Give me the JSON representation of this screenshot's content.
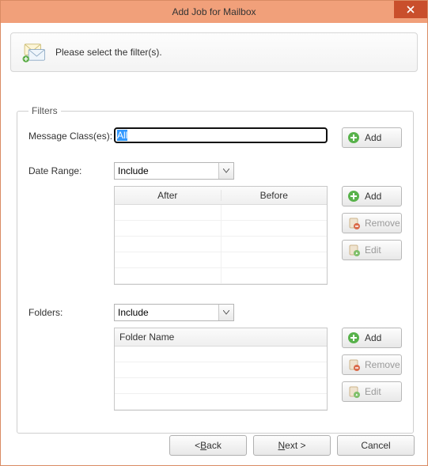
{
  "window": {
    "title": "Add Job for Mailbox"
  },
  "banner": {
    "text": "Please select the filter(s)."
  },
  "filters": {
    "legend": "Filters",
    "message_class": {
      "label": "Message Class(es):",
      "value": "All"
    },
    "date_range": {
      "label": "Date Range:",
      "mode": "Include",
      "columns": {
        "after": "After",
        "before": "Before"
      }
    },
    "folders": {
      "label": "Folders:",
      "mode": "Include",
      "column": "Folder Name"
    }
  },
  "buttons": {
    "add": "Add",
    "remove": "Remove",
    "edit": "Edit"
  },
  "footer": {
    "back_prefix": "< ",
    "back_u": "B",
    "back_rest": "ack",
    "next_u": "N",
    "next_rest": "ext >",
    "cancel": "Cancel"
  }
}
